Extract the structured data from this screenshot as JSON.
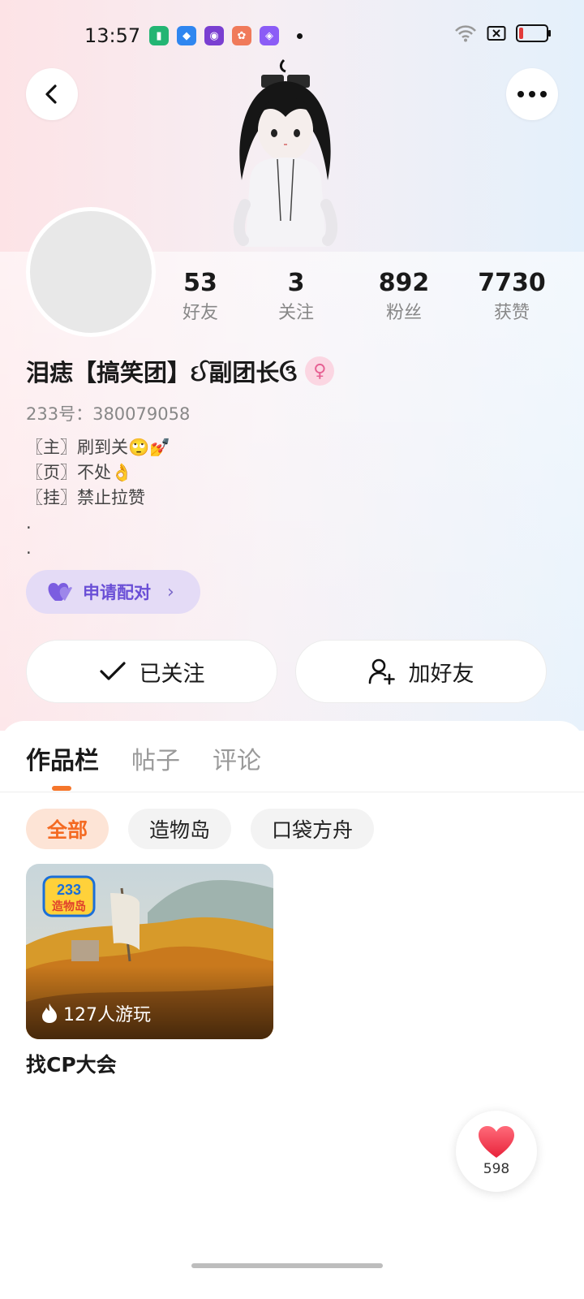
{
  "status_bar": {
    "time": "13:57",
    "icons": [
      "app-notification-icon",
      "app-notification-icon",
      "app-notification-icon",
      "app-notification-icon",
      "app-notification-icon"
    ],
    "right_icons": [
      "wifi-icon",
      "sim-blocked-icon",
      "battery-icon"
    ],
    "battery_level": 0.15,
    "battery_color": "#e23b3b"
  },
  "header": {
    "back_icon": "chevron-left-icon",
    "more_icon": "more-horizontal-icon"
  },
  "profile": {
    "stats": [
      {
        "value": "53",
        "label": "好友"
      },
      {
        "value": "3",
        "label": "关注"
      },
      {
        "value": "892",
        "label": "粉丝"
      },
      {
        "value": "7730",
        "label": "获赞"
      }
    ],
    "nickname": "泪痣【搞笑团】ઈ副团长ઉ",
    "gender_icon": "female-icon",
    "uid": "233号：380079058",
    "bio": [
      "〖主〗刷到关🙄💅",
      "〖页〗不处👌",
      "〖挂〗禁止拉赞",
      ".",
      "."
    ],
    "pair_button": "申请配对",
    "follow_button": "已关注",
    "add_friend_button": "加好友"
  },
  "tabs": {
    "items": [
      "作品栏",
      "帖子",
      "评论"
    ],
    "active_index": 0,
    "accent": "#f5762b"
  },
  "filters": {
    "items": [
      "全部",
      "造物岛",
      "口袋方舟"
    ],
    "active_index": 0
  },
  "works": [
    {
      "plays": "127人游玩",
      "logo_text": "233",
      "logo_sub": "造物岛",
      "title": "找CP大会"
    }
  ],
  "like_fab": {
    "count": "598",
    "heart_color": "#f0394d"
  }
}
